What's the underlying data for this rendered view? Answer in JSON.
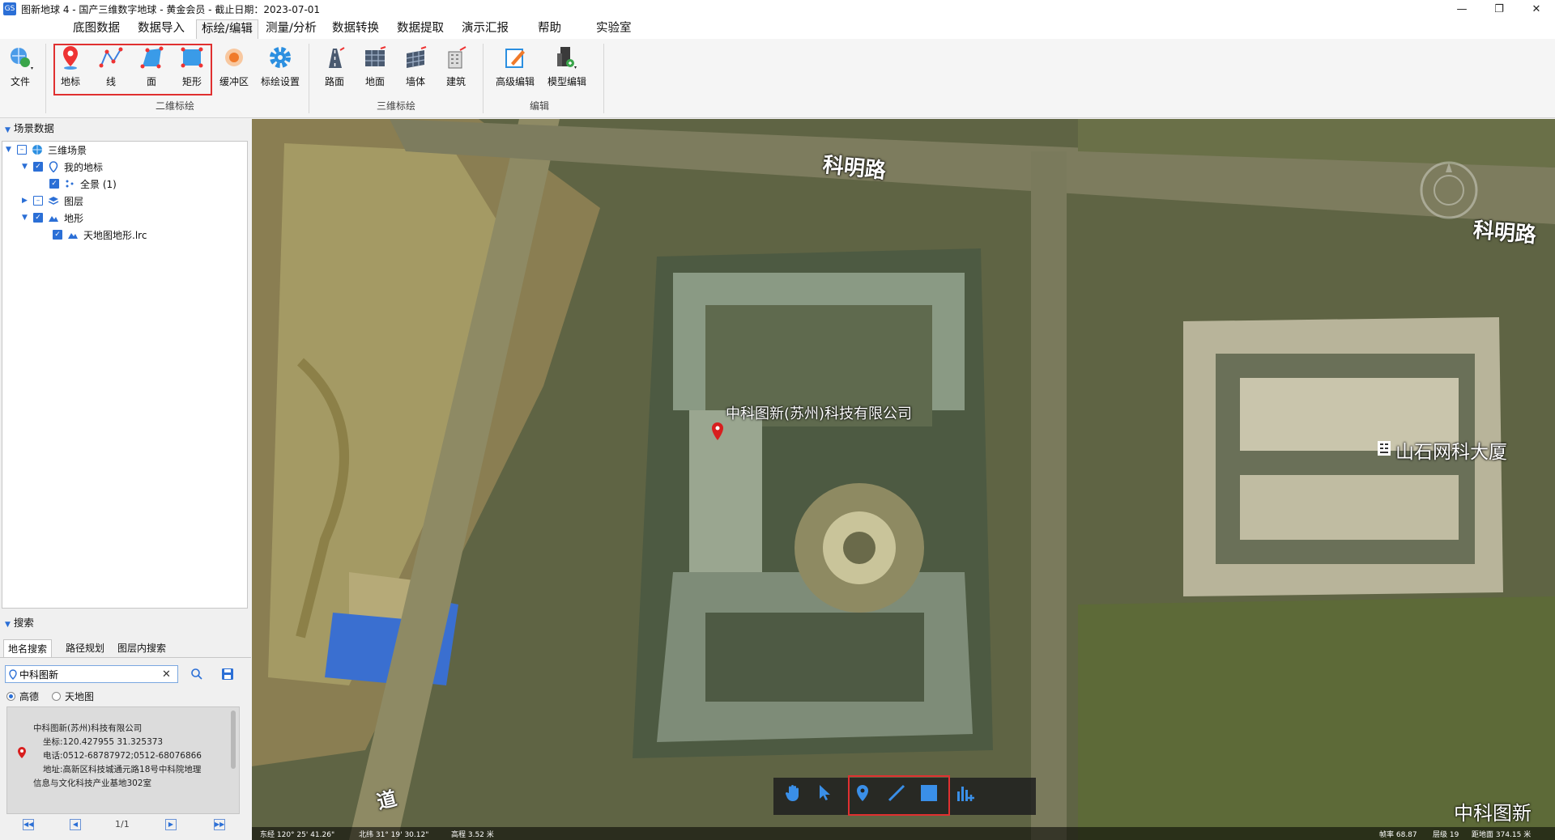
{
  "window": {
    "title": "图新地球 4 - 国产三维数字地球 - 黄金会员 - 截止日期：2023-07-01",
    "icon_label": "GS"
  },
  "menu": [
    "底图数据",
    "数据导入",
    "标绘/编辑",
    "测量/分析",
    "数据转换",
    "数据提取",
    "演示汇报",
    "帮助",
    "实验室"
  ],
  "ribbon": {
    "file": "文件",
    "group_2d": {
      "label": "二维标绘",
      "items": [
        "地标",
        "线",
        "面",
        "矩形",
        "缓冲区",
        "标绘设置"
      ]
    },
    "group_3d": {
      "label": "三维标绘",
      "items": [
        "路面",
        "地面",
        "墙体",
        "建筑"
      ]
    },
    "group_edit": {
      "label": "编辑",
      "items": [
        "高级编辑",
        "模型编辑"
      ]
    }
  },
  "scene_panel": {
    "header": "场景数据",
    "tree": [
      {
        "label": "三维场景"
      },
      {
        "label": "我的地标"
      },
      {
        "label": "全景 (1)"
      },
      {
        "label": "图层"
      },
      {
        "label": "地形"
      },
      {
        "label": "天地图地形.lrc"
      }
    ]
  },
  "search_panel": {
    "header": "搜索",
    "tabs": [
      "地名搜索",
      "路径规划",
      "图层内搜索"
    ],
    "query": "中科图新",
    "sources": [
      "高德",
      "天地图"
    ],
    "result": {
      "name": "中科图新(苏州)科技有限公司",
      "coords": "坐标:120.427955 31.325373",
      "phone": "电话:0512-68787972;0512-68076866",
      "address1": "地址:高新区科技城通元路18号中科院地理",
      "address2": "信息与文化科技产业基地302室"
    },
    "page": "1/1"
  },
  "map": {
    "labels": {
      "road1": "科明路",
      "road2": "科明路",
      "company": "中科图新(苏州)科技有限公司",
      "building": "山石网科大厦",
      "road3": "道",
      "watermark": "中科图新"
    },
    "status": {
      "lng": "东经 120° 25' 41.26\"",
      "lat": "北纬 31° 19' 30.12\"",
      "alt": "高程 3.52 米",
      "fps": "帧率 68.87",
      "level": "层级 19",
      "dist": "距地面 374.15 米"
    }
  },
  "colors": {
    "accent": "#2b6fd6",
    "highlight": "#e03030",
    "marker": "#d81e1e"
  }
}
